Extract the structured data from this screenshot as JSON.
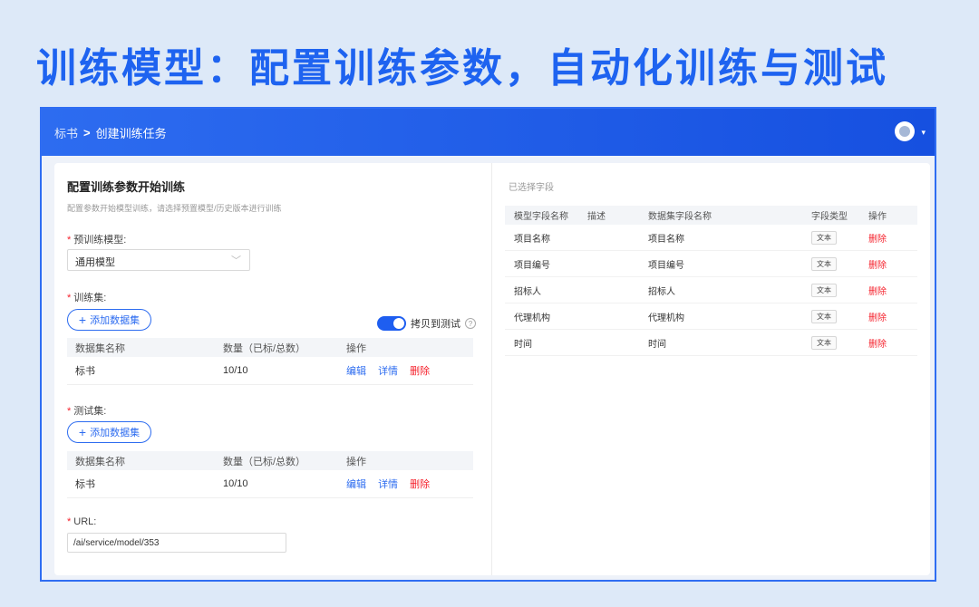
{
  "headline": "训练模型：配置训练参数，自动化训练与测试",
  "breadcrumb": {
    "root": "标书",
    "separator": ">",
    "current": "创建训练任务"
  },
  "form": {
    "title": "配置训练参数开始训练",
    "description": "配置参数开始模型训练，请选择预置模型/历史版本进行训练",
    "required_mark": "*",
    "model_label": "预训练模型:",
    "model_value": "通用模型",
    "train_label": "训练集:",
    "add_dataset_label": "添加数据集",
    "copy_to_test_label": "拷贝到测试",
    "copy_to_test_on": true,
    "test_label": "测试集:",
    "url_label": "URL:",
    "url_value": "/ai/service/model/353",
    "table_headers": [
      "数据集名称",
      "数量（已标/总数）",
      "操作"
    ],
    "train_rows": [
      {
        "name": "标书",
        "count": "10/10"
      }
    ],
    "test_rows": [
      {
        "name": "标书",
        "count": "10/10"
      }
    ],
    "actions": {
      "edit": "编辑",
      "detail": "详情",
      "delete": "删除"
    }
  },
  "fields": {
    "title": "已选择字段",
    "headers": [
      "模型字段名称",
      "描述",
      "数据集字段名称",
      "字段类型",
      "操作"
    ],
    "rows": [
      {
        "model_field": "项目名称",
        "desc": "",
        "dataset_field": "项目名称",
        "type": "文本",
        "action": "删除"
      },
      {
        "model_field": "项目编号",
        "desc": "",
        "dataset_field": "项目编号",
        "type": "文本",
        "action": "删除"
      },
      {
        "model_field": "招标人",
        "desc": "",
        "dataset_field": "招标人",
        "type": "文本",
        "action": "删除"
      },
      {
        "model_field": "代理机构",
        "desc": "",
        "dataset_field": "代理机构",
        "type": "文本",
        "action": "删除"
      },
      {
        "model_field": "时间",
        "desc": "",
        "dataset_field": "时间",
        "type": "文本",
        "action": "删除"
      }
    ]
  },
  "colors": {
    "accent": "#2d6cf0",
    "danger": "#f5222d",
    "headline": "#1e63f0",
    "background": "#dde9f8"
  }
}
